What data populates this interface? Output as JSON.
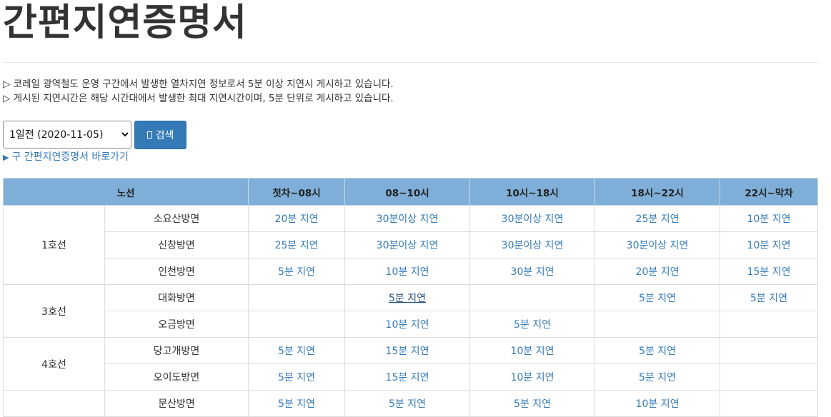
{
  "page": {
    "title": "간편지연증명서",
    "notes": [
      "▷ 코레일 광역철도 운영 구간에서 발생한 열차지연 정보로서 5분 이상 지연시 게시하고 있습니다.",
      "▷ 게시된 지연시간은 해당 시간대에서 발생한 최대 지연시간이며, 5분 단위로 게시하고 있습니다."
    ]
  },
  "controls": {
    "date_selected": "1일전 (2020-11-05)",
    "search_label": "검색",
    "old_link_label": "구 간편지연증명서 바로가기",
    "search_icon": "search-icon"
  },
  "colors": {
    "accent": "#337ab7",
    "header_bg": "#7fafd8"
  },
  "table": {
    "headers": [
      "노선",
      "첫차~08시",
      "08~10시",
      "10시~18시",
      "18시~22시",
      "22시~막차"
    ],
    "groups": [
      {
        "line": "1호선",
        "rows": [
          {
            "direction": "소요산방면",
            "values": [
              "20분 지연",
              "30분이상 지연",
              "30분이상 지연",
              "25분 지연",
              "10분 지연"
            ]
          },
          {
            "direction": "신창방면",
            "values": [
              "25분 지연",
              "30분이상 지연",
              "30분이상 지연",
              "30분이상 지연",
              "10분 지연"
            ]
          },
          {
            "direction": "인천방면",
            "values": [
              "5분 지연",
              "10분 지연",
              "30분 지연",
              "20분 지연",
              "15분 지연"
            ]
          }
        ]
      },
      {
        "line": "3호선",
        "rows": [
          {
            "direction": "대화방면",
            "values": [
              "",
              "5분 지연",
              "",
              "5분 지연",
              "5분 지연"
            ]
          },
          {
            "direction": "오금방면",
            "values": [
              "",
              "10분 지연",
              "5분 지연",
              "",
              ""
            ]
          }
        ]
      },
      {
        "line": "4호선",
        "rows": [
          {
            "direction": "당고개방면",
            "values": [
              "5분 지연",
              "15분 지연",
              "10분 지연",
              "5분 지연",
              ""
            ]
          },
          {
            "direction": "오이도방면",
            "values": [
              "5분 지연",
              "15분 지연",
              "10분 지연",
              "5분 지연",
              ""
            ]
          }
        ]
      },
      {
        "line": "",
        "rows": [
          {
            "direction": "문산방면",
            "values": [
              "5분 지연",
              "5분 지연",
              "5분 지연",
              "10분 지연",
              ""
            ]
          }
        ]
      }
    ]
  }
}
